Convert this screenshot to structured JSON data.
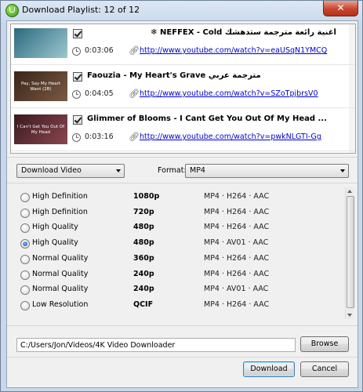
{
  "window": {
    "title": "Download Playlist: 12 of 12",
    "close_label": "✕"
  },
  "videos": [
    {
      "thumb_text": "",
      "title": "أغنية رائعة مترجمة ستدهشك NEFFEX - Cold ❄",
      "rtl": true,
      "duration": "0:03:06",
      "url": "http://www.youtube.com/watch?v=eaUSqN1YMCQ",
      "checked": true,
      "thumb_colors": [
        "#2b6a7e",
        "#9cc7cf"
      ]
    },
    {
      "thumb_text": "Pay, Say My Heart Want (2B)",
      "title": "Faouzia - My Heart's Grave مترجمة عربي",
      "rtl": false,
      "duration": "0:04:05",
      "url": "http://www.youtube.com/watch?v=SZoTpjbrsV0",
      "checked": true,
      "thumb_colors": [
        "#3a2418",
        "#7a5a44"
      ]
    },
    {
      "thumb_text": "I Can't Get You Out Of My Head",
      "title": "Glimmer of Blooms - I Cant Get You Out Of My Head ...",
      "rtl": false,
      "duration": "0:03:16",
      "url": "http://www.youtube.com/watch?v=pwkNLGTI-Gg",
      "checked": true,
      "thumb_colors": [
        "#3a1a1e",
        "#8a4650"
      ]
    }
  ],
  "controls": {
    "download_type": "Download Video",
    "format_label": "Format:",
    "format_value": "MP4"
  },
  "qualities": [
    {
      "label": "High Definition",
      "res": "1080p",
      "fmt": "MP4 · H264 · AAC",
      "selected": false
    },
    {
      "label": "High Definition",
      "res": "720p",
      "fmt": "MP4 · H264 · AAC",
      "selected": false
    },
    {
      "label": "High Quality",
      "res": "480p",
      "fmt": "MP4 · H264 · AAC",
      "selected": false
    },
    {
      "label": "High Quality",
      "res": "480p",
      "fmt": "MP4 · AV01 · AAC",
      "selected": true
    },
    {
      "label": "Normal Quality",
      "res": "360p",
      "fmt": "MP4 · H264 · AAC",
      "selected": false
    },
    {
      "label": "Normal Quality",
      "res": "240p",
      "fmt": "MP4 · H264 · AAC",
      "selected": false
    },
    {
      "label": "Normal Quality",
      "res": "240p",
      "fmt": "MP4 · AV01 · AAC",
      "selected": false
    },
    {
      "label": "Low Resolution",
      "res": "QCIF",
      "fmt": "MP4 · H264 · AAC",
      "selected": false
    }
  ],
  "output": {
    "path": "C:/Users/Jon/Videos/4K Video Downloader",
    "browse_label": "Browse"
  },
  "actions": {
    "download_label": "Download",
    "cancel_label": "Cancel"
  }
}
